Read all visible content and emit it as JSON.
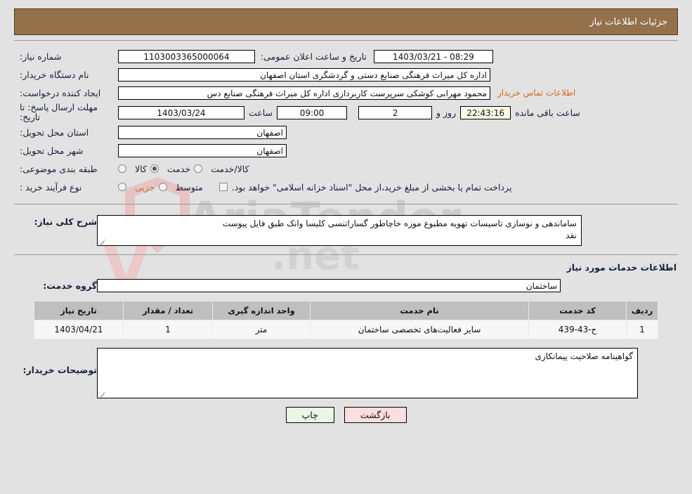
{
  "header": {
    "title": "جزئیات اطلاعات نیاز"
  },
  "info": {
    "need_number_label": "شماره نیاز:",
    "need_number_value": "1103003365000064",
    "announce_label": "تاریخ و ساعت اعلان عمومی:",
    "announce_value": "08:29 - 1403/03/21",
    "buyer_org_label": "نام دستگاه خریدار:",
    "buyer_org_value": "اداره کل میراث فرهنگی  صنایع دستی و گردشگری استان اصفهان",
    "creator_label": "ایجاد کننده درخواست:",
    "creator_value": "محمود مهرابی کوشکی سرپرست کاربردازی اداره کل میراث فرهنگی  صنایع دس",
    "contact_link": "اطلاعات تماس خریدار",
    "deadline_label": "مهلت ارسال پاسخ: تا تاریخ:",
    "deadline_date": "1403/03/24",
    "time_word": "ساعت",
    "deadline_time": "09:00",
    "days_value": "2",
    "days_word": "روز و",
    "countdown": "22:43:16",
    "remaining_word": "ساعت باقی مانده",
    "province_label": "استان محل تحویل:",
    "province_value": "اصفهان",
    "city_label": "شهر محل تحویل:",
    "city_value": "اصفهان",
    "category_label": "طبقه بندی موضوعی:",
    "category_options": [
      "کالا",
      "خدمت",
      "کالا/خدمت"
    ],
    "category_selected": "خدمت",
    "process_label": "نوع فرآیند خرید :",
    "process_options": [
      "جزیی",
      "متوسط"
    ],
    "process_selected": "",
    "treasury_note": "پرداخت تمام یا بخشی از مبلغ خرید،از محل \"اسناد خزانه اسلامی\" خواهد بود."
  },
  "summary": {
    "label": "شرح کلی نیاز:",
    "line1": "ساماندهی و نوسازی تاسیسات تهویه مطبوع موزه خاچاطور گساراتنسی کلیسا وانک طبق فایل پیوست",
    "line2": "نقد"
  },
  "services_section": {
    "title": "اطلاعات خدمات مورد نیاز",
    "group_label": "گروه خدمت:",
    "group_value": "ساختمان"
  },
  "table": {
    "columns": [
      "ردیف",
      "کد خدمت",
      "نام خدمت",
      "واحد اندازه گیری",
      "تعداد / مقدار",
      "تاریخ نیاز"
    ],
    "rows": [
      {
        "index": "1",
        "code": "ج-43-439",
        "name": "سایر فعالیت‌های تخصصی ساختمان",
        "unit": "متر",
        "qty": "1",
        "date": "1403/04/21"
      }
    ]
  },
  "buyer_notes": {
    "label": "توضیحات خریدار:",
    "value": "گواهینامه صلاحیت پیمانکاری"
  },
  "footer": {
    "print_label": "چاپ",
    "back_label": "بازگشت"
  },
  "watermark": {
    "brand": "AriaTender",
    "suffix": ".net"
  },
  "colors": {
    "header_bg": "#94714a",
    "link": "#d2691e",
    "accent": "#c0703a",
    "table_header": "#bfbfbf"
  }
}
